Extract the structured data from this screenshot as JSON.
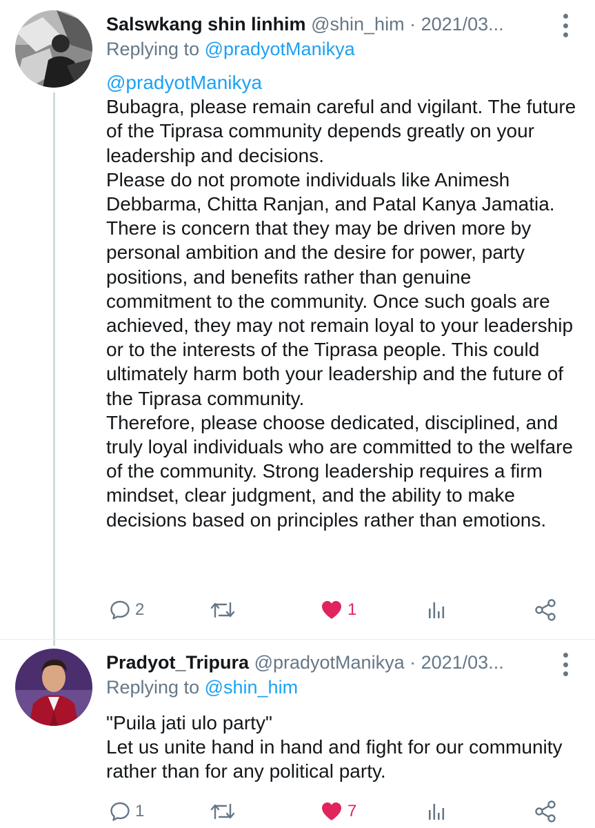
{
  "thread": [
    {
      "display_name": "Salswkang shin linhim",
      "handle": "@shin_him",
      "separator": " · ",
      "date": "2021/03...",
      "replying_prefix": "Replying to ",
      "replying_to": "@pradyotManikya",
      "mention": "@pradyotManikya",
      "paragraphs": [
        "Bubagra, please remain careful and vigilant. The future of the Tiprasa community depends greatly on your leadership and decisions.",
        "Please do not promote individuals like Animesh Debbarma, Chitta Ranjan, and Patal Kanya Jamatia. There is concern that they may be driven more by personal ambition and the desire for power, party positions, and benefits rather than genuine commitment to the community. Once such goals are achieved, they may not remain loyal to your leadership or to the interests of the Tiprasa people. This could ultimately harm both your leadership and the future of the Tiprasa community.",
        "Therefore, please choose dedicated, disciplined, and truly loyal individuals who are committed to the welfare of the community. Strong leadership requires a firm mindset, clear judgment, and the ability to make decisions based on principles rather than emotions."
      ],
      "reply_count": "2",
      "retweet_count": "",
      "like_count": "1",
      "liked": true
    },
    {
      "display_name": "Pradyot_Tripura",
      "handle": "@pradyotManikya",
      "separator": " · ",
      "date": "2021/03...",
      "replying_prefix": "Replying to ",
      "replying_to": "@shin_him",
      "paragraphs": [
        "\"Puila jati ulo party\"",
        "Let us unite hand in hand and fight for our community rather than for any political party."
      ],
      "reply_count": "1",
      "retweet_count": "",
      "like_count": "7",
      "liked": true
    }
  ],
  "icons": {
    "reply": "speech-bubble-icon",
    "retweet": "retweet-arrows-icon",
    "like": "heart-icon",
    "stats": "bar-chart-icon",
    "share": "share-icon",
    "more": "vertical-dots-icon"
  },
  "colors": {
    "link": "#1da1f2",
    "meta": "#657786",
    "text": "#14171a",
    "like": "#e0245e",
    "thread_line": "#cfd9de"
  }
}
